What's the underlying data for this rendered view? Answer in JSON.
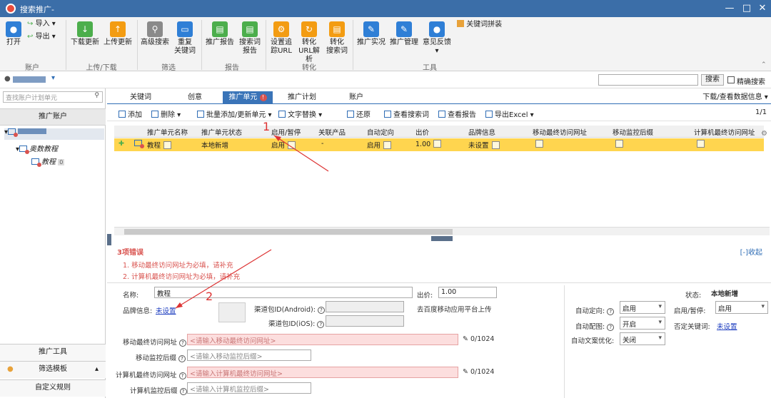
{
  "window": {
    "title": "搜索推广-"
  },
  "ribbon": {
    "open": "打开",
    "import": "导入",
    "export": "导出",
    "download_update": "下载更新",
    "upload_update": "上传更新",
    "advanced_search": "高级搜索",
    "reset_keywords_1": "重复",
    "reset_keywords_2": "关键词",
    "promo_report": "推广报告",
    "search_term_report_1": "搜索词",
    "search_term_report_2": "报告",
    "set_track_url_1": "设置追",
    "set_track_url_2": "踪URL",
    "convert_url_1": "转化",
    "convert_url_2": "URL解析",
    "convert_search_1": "转化",
    "convert_search_2": "搜索词",
    "promo_live": "推广实况",
    "promo_manage": "推广管理",
    "feedback": "意见反馈",
    "keyword_tool": "关键词拼装",
    "groups": {
      "account": "账户",
      "updown": "上传/下载",
      "filter": "筛选",
      "report": "报告",
      "convert": "转化",
      "tools": "工具"
    }
  },
  "acctbar": {
    "search_btn": "搜索",
    "exact_search": "精确搜索"
  },
  "left": {
    "search_placeholder": "查找账户计划单元",
    "header": "推广账户",
    "plan": "奥数教程",
    "unit": "教程",
    "unit_count": "0",
    "promo_tools": "推广工具",
    "filter_template": "筛选模板",
    "custom_rules": "自定义规则"
  },
  "tabs": [
    {
      "label": "关键词"
    },
    {
      "label": "创意"
    },
    {
      "label": "推广单元"
    },
    {
      "label": "推广计划"
    },
    {
      "label": "账户"
    }
  ],
  "download_view": "下载/查看数据信息",
  "toolbar": {
    "add": "添加",
    "delete": "删除",
    "batch": "批量添加/更新单元",
    "text_replace": "文字替换",
    "restore": "还原",
    "view_terms": "查看搜索词",
    "view_report": "查看报告",
    "export_excel": "导出Excel",
    "page": "1/1"
  },
  "table": {
    "headers": [
      "推广单元名称",
      "推广单元状态",
      "启用/暂停",
      "关联产品",
      "自动定向",
      "出价",
      "品牌信息",
      "移动最终访问网址",
      "移动监控后缀",
      "计算机最终访问网址"
    ],
    "row": [
      "教程",
      "本地新增",
      "启用",
      "-",
      "启用",
      "1.00",
      "未设置"
    ]
  },
  "errors": {
    "header": "3项错误",
    "collapse": "[-]收起",
    "items": [
      "1. 移动最终访问网址为必填，请补充",
      "2. 计算机最终访问网址为必填，请补充"
    ]
  },
  "form": {
    "name_label": "名称:",
    "name_value": "教程",
    "bid_label": "出价:",
    "bid_value": "1.00",
    "status_label": "状态:",
    "status_value": "本地新增",
    "brand_label": "品牌信息:",
    "brand_value": "未设置",
    "android_label": "渠道包ID(Android):",
    "ios_label": "渠道包ID(iOS):",
    "upload_note": "去百度移动应用平台上传",
    "auto_target_label": "自动定向:",
    "auto_target_value": "启用",
    "enable_pause_label": "启用/暂停:",
    "enable_pause_value": "启用",
    "auto_match_label": "自动配图:",
    "auto_match_value": "开启",
    "negative_label": "否定关键词:",
    "negative_value": "未设置",
    "auto_opt_label": "自动文案优化:",
    "auto_opt_value": "关闭",
    "mobile_url_label": "移动最终访问网址",
    "mobile_url_ph": "<请输入移动最终访问网址>",
    "mobile_count": "0/1024",
    "mobile_track_label": "移动监控后缀",
    "mobile_track_ph": "<请输入移动监控后缀>",
    "pc_url_label": "计算机最终访问网址",
    "pc_url_ph": "<请输入计算机最终访问网址>",
    "pc_count": "0/1024",
    "pc_track_label": "计算机监控后缀",
    "pc_track_ph": "<请输入计算机监控后缀>"
  },
  "annotations": {
    "one": "1",
    "two": "2"
  }
}
